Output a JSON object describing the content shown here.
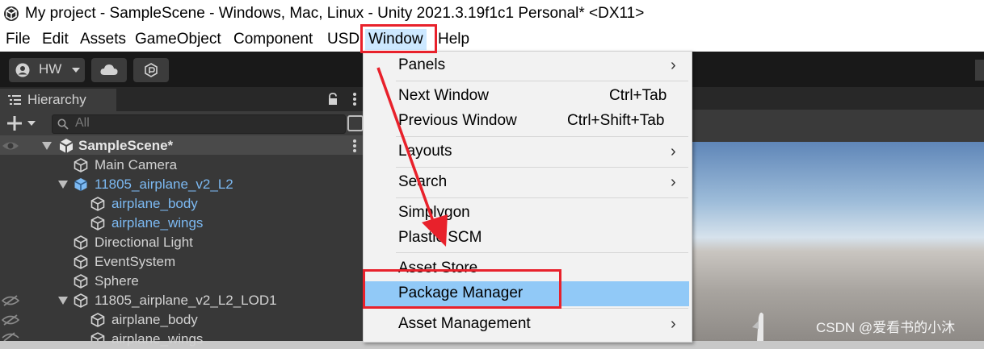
{
  "window": {
    "title": "My project - SampleScene - Windows, Mac, Linux - Unity 2021.3.19f1c1 Personal* <DX11>"
  },
  "menubar": {
    "items": [
      "File",
      "Edit",
      "Assets",
      "GameObject",
      "Component",
      "USD",
      "Window",
      "Help"
    ]
  },
  "toolbar": {
    "account_label": "HW"
  },
  "hierarchy": {
    "tab_label": "Hierarchy",
    "search_placeholder": "All",
    "scene_name": "SampleScene*",
    "rows": [
      {
        "label": "Main Camera"
      },
      {
        "label": "11805_airplane_v2_L2"
      },
      {
        "label": "airplane_body"
      },
      {
        "label": "airplane_wings"
      },
      {
        "label": "Directional Light"
      },
      {
        "label": "EventSystem"
      },
      {
        "label": "Sphere"
      },
      {
        "label": "11805_airplane_v2_L2_LOD1"
      },
      {
        "label": "airplane_body"
      },
      {
        "label": "airplane_wings"
      }
    ]
  },
  "window_menu": {
    "items": [
      {
        "label": "Panels"
      },
      {
        "label": "Next Window",
        "shortcut": "Ctrl+Tab"
      },
      {
        "label": "Previous Window",
        "shortcut": "Ctrl+Shift+Tab"
      },
      {
        "label": "Layouts"
      },
      {
        "label": "Search"
      },
      {
        "label": "Simplygon"
      },
      {
        "label": "Plastic SCM"
      },
      {
        "label": "Asset Store"
      },
      {
        "label": "Package Manager"
      },
      {
        "label": "Asset Management"
      }
    ]
  },
  "watermark": "CSDN @爱看书的小沐",
  "colors": {
    "highlight": "#91c9f7",
    "annotation_red": "#e8212b",
    "prefab_blue": "#7cb9f2"
  }
}
